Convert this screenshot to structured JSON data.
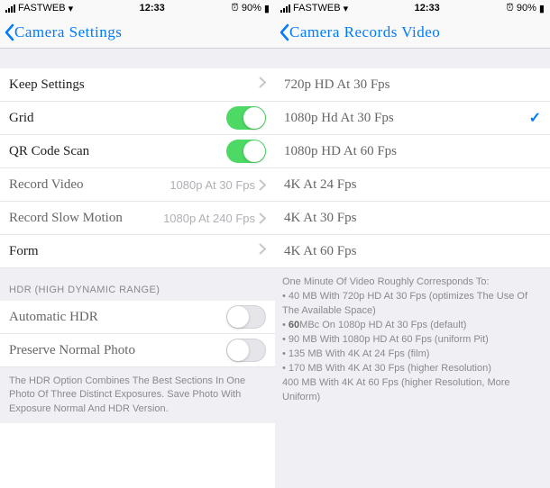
{
  "left": {
    "status": {
      "carrier": "FASTWEB",
      "time": "12:33",
      "battery": "90%"
    },
    "nav": {
      "title": "Camera Settings"
    },
    "rows": {
      "keep": {
        "label": "Keep Settings"
      },
      "grid": {
        "label": "Grid"
      },
      "qr": {
        "label": "QR Code Scan"
      },
      "record_video": {
        "label": "Record Video",
        "value": "1080p At 30 Fps"
      },
      "record_slow": {
        "label": "Record Slow Motion",
        "value": "1080p At 240 Fps"
      },
      "form": {
        "label": "Form"
      }
    },
    "hdr": {
      "header": "HDR (HIGH DYNAMIC RANGE)",
      "auto": "Automatic HDR",
      "preserve": "Preserve Normal Photo",
      "footer": "The HDR Option Combines The Best Sections In One Photo Of Three Distinct Exposures. Save Photo With Exposure Normal And HDR Version."
    }
  },
  "right": {
    "status": {
      "carrier": "FASTWEB",
      "time": "12:33",
      "battery": "90%"
    },
    "nav": {
      "title": "Camera Records Video"
    },
    "options": [
      {
        "label": "720p HD At 30 Fps",
        "selected": false
      },
      {
        "label": "1080p Hd At 30 Fps",
        "selected": true
      },
      {
        "label": "1080p HD At 60 Fps",
        "selected": false
      },
      {
        "label": "4K At 24 Fps",
        "selected": false
      },
      {
        "label": "4K At 30 Fps",
        "selected": false
      },
      {
        "label": "4K At 60 Fps",
        "selected": false
      }
    ],
    "info": {
      "l1": "One Minute Of Video Roughly Corresponds To:",
      "l2": "• 40 MB With 720p HD At 30 Fps (optimizes The Use Of The Available Space)",
      "l3_a": "• ",
      "l3_b": "60",
      "l3_c": "MBc On 1080p HD At 30 Fps (default)",
      "l4": "• 90 MB With 1080p HD At 60 Fps (uniform Pit)",
      "l5": "• 135 MB With 4K At 24 Fps (film)",
      "l6": "• 170 MB With 4K At 30 Fps (higher Resolution)",
      "l7": "400 MB With 4K At 60 Fps (higher Resolution, More Uniform)"
    }
  }
}
